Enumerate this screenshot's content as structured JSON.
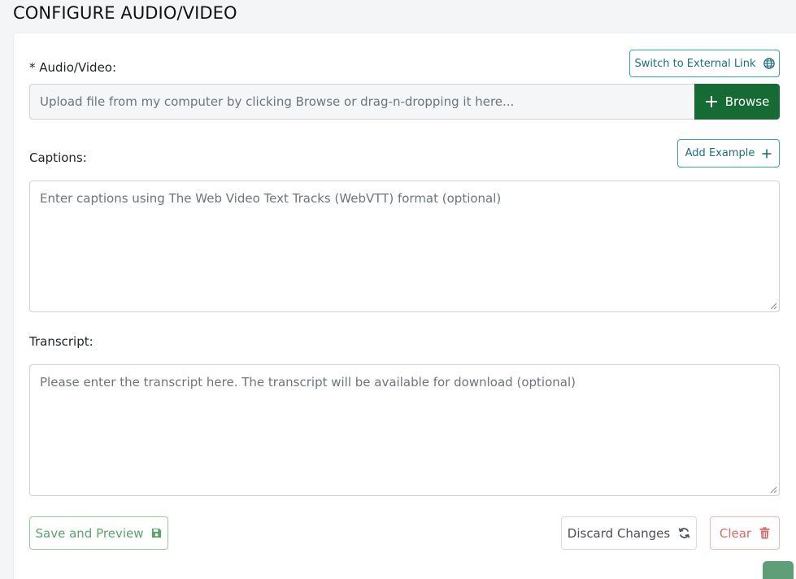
{
  "page": {
    "title": "CONFIGURE AUDIO/VIDEO"
  },
  "audio_video": {
    "label": "* Audio/Video:",
    "switch_label": "Switch to External Link",
    "upload_placeholder": "Upload file from my computer by clicking Browse or drag-n-dropping it here...",
    "browse_label": "Browse"
  },
  "captions": {
    "label": "Captions:",
    "add_example_label": "Add Example",
    "placeholder": "Enter captions using The Web Video Text Tracks (WebVTT) format (optional)"
  },
  "transcript": {
    "label": "Transcript:",
    "placeholder": "Please enter the transcript here. The transcript will be available for download (optional)"
  },
  "actions": {
    "save_label": "Save and Preview",
    "discard_label": "Discard Changes",
    "clear_label": "Clear"
  },
  "icons": {
    "switch": "globe-icon",
    "browse": "plus-icon",
    "add_example": "plus-icon",
    "save": "floppy-disk-icon",
    "discard": "refresh-icon",
    "clear": "trash-icon"
  },
  "colors": {
    "browse_bg": "#166b35",
    "teal_outline": "#3aa3b3",
    "save_green": "#5aa36b",
    "clear_red": "#d96a6a"
  }
}
